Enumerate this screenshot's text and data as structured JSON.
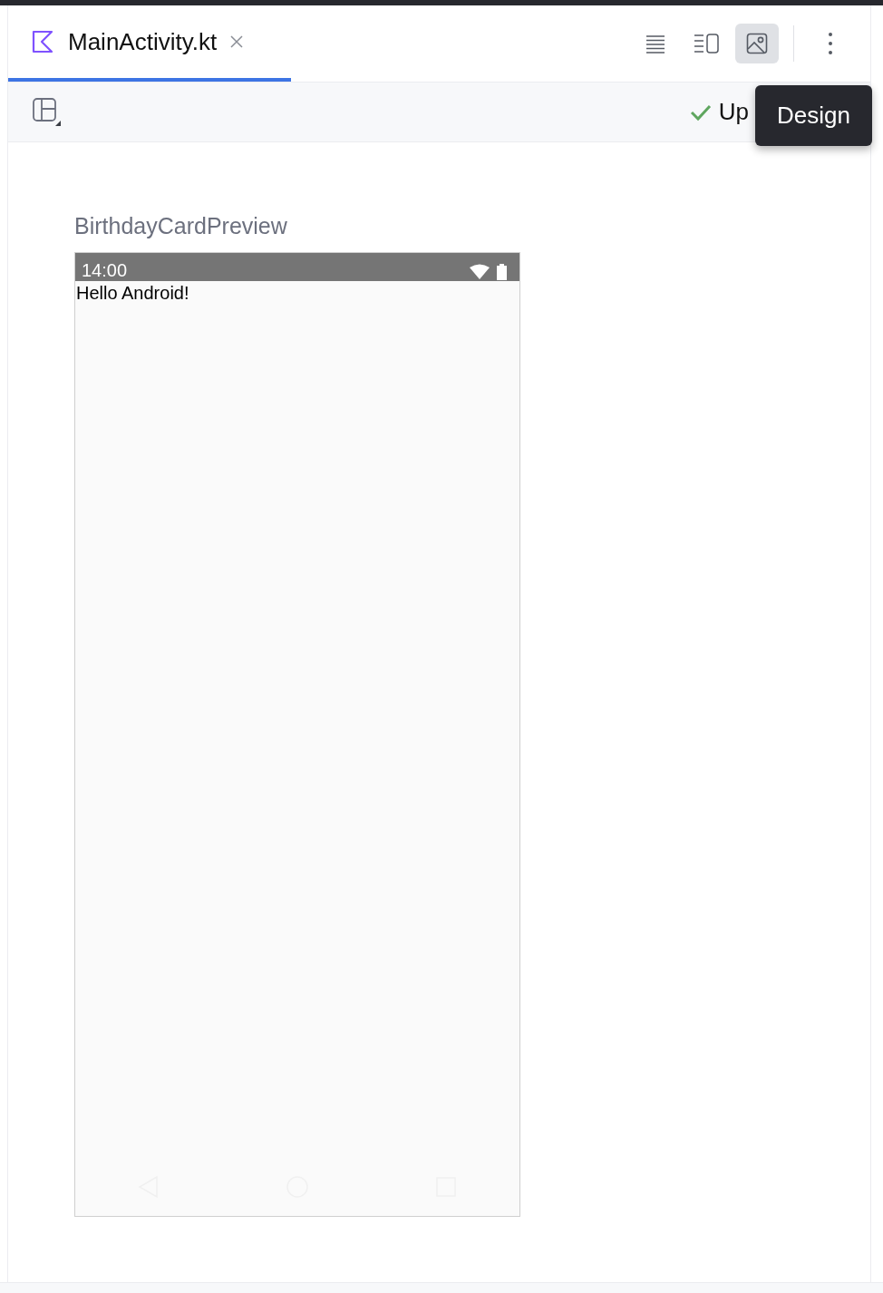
{
  "tab": {
    "label": "MainActivity.kt",
    "selected": true
  },
  "view_modes": [
    {
      "kind": "code",
      "selected": false
    },
    {
      "kind": "split",
      "selected": false
    },
    {
      "kind": "design",
      "selected": true
    }
  ],
  "status": {
    "text": "Up"
  },
  "tooltip": {
    "text": "Design"
  },
  "preview": {
    "title": "BirthdayCardPreview",
    "status_time": "14:00",
    "content": "Hello Android!"
  }
}
